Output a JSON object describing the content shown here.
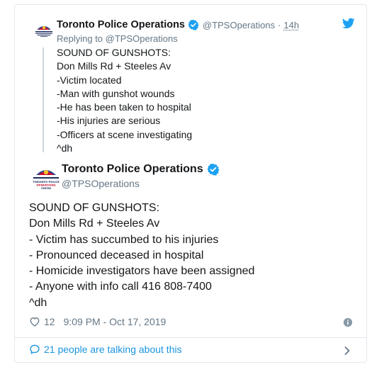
{
  "parent_tweet": {
    "name": "Toronto Police Operations",
    "handle": "@TPSOperations",
    "separator": "·",
    "time": "14h",
    "reply_prefix": "Replying to",
    "reply_to": "@TPSOperations",
    "lines": [
      "SOUND OF GUNSHOTS:",
      "Don Mills Rd + Steeles Av",
      "-Victim located",
      "-Man with gunshot wounds",
      "-He has been taken to hospital",
      "-His injuries are serious",
      "-Officers at scene investigating",
      "^dh"
    ]
  },
  "main_tweet": {
    "name": "Toronto Police Operations",
    "handle": "@TPSOperations",
    "lines": [
      "SOUND OF GUNSHOTS:",
      "Don Mills Rd + Steeles Av",
      "- Victim has succumbed to his injuries",
      "- Pronounced deceased in hospital",
      "- Homicide investigators have been assigned",
      "- Anyone with info call 416 808-7400",
      "^dh"
    ],
    "likes": "12",
    "timestamp": "9:09 PM - Oct 17, 2019"
  },
  "footer": {
    "talking": "21 people are talking about this"
  },
  "avatar_text": {
    "line1": "TORONTO POLICE",
    "line2": "OPERATIONS",
    "line3": "CENTRE"
  },
  "icons": {
    "bird": "twitter-bird-icon",
    "verified": "verified-badge-icon",
    "heart": "heart-icon",
    "info": "info-icon",
    "bubble": "speech-bubble-icon",
    "chevron": "chevron-right-icon"
  },
  "colors": {
    "twitter_blue": "#1da1f2",
    "link_blue": "#1b95e0",
    "text": "#14171a",
    "muted": "#657786",
    "border": "#e1e8ed"
  }
}
